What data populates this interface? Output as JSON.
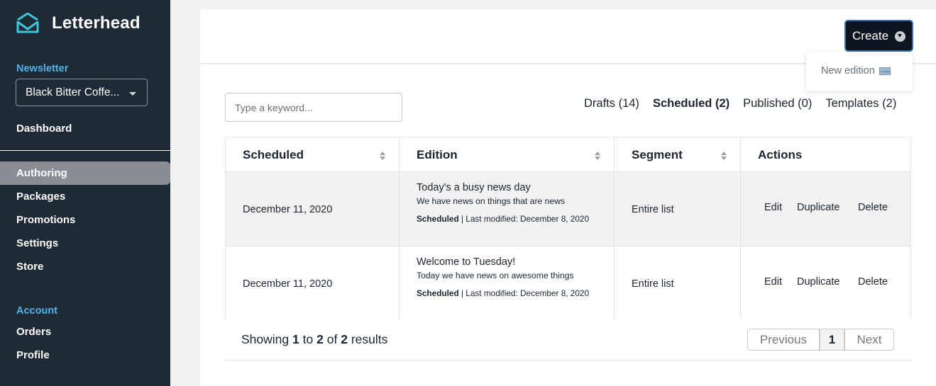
{
  "brand": {
    "name": "Letterhead"
  },
  "sidebar": {
    "newsletter_label": "Newsletter",
    "newsletter_value": "Black Bitter Coffe...",
    "dashboard": "Dashboard",
    "items": [
      {
        "label": "Authoring",
        "active": true
      },
      {
        "label": "Packages"
      },
      {
        "label": "Promotions"
      },
      {
        "label": "Settings"
      },
      {
        "label": "Store"
      }
    ],
    "account_label": "Account",
    "account_items": [
      {
        "label": "Orders"
      },
      {
        "label": "Profile"
      }
    ]
  },
  "header": {
    "create_label": "Create",
    "dropdown_item": "New edition"
  },
  "search": {
    "placeholder": "Type a keyword..."
  },
  "tabs": [
    {
      "label": "Drafts (14)"
    },
    {
      "label": "Scheduled (2)",
      "active": true
    },
    {
      "label": "Published (0)"
    },
    {
      "label": "Templates (2)"
    }
  ],
  "table": {
    "columns": [
      "Scheduled",
      "Edition",
      "Segment",
      "Actions"
    ],
    "rows": [
      {
        "scheduled": "December 11, 2020",
        "title": "Today's a busy news day",
        "description": "We have news on things that are news",
        "status": "Scheduled",
        "modified": "| Last modified: December 8, 2020",
        "segment": "Entire list",
        "actions": [
          "Edit",
          "Duplicate",
          "Delete"
        ]
      },
      {
        "scheduled": "December 11, 2020",
        "title": "Welcome to Tuesday!",
        "description": "Today we have news on awesome things",
        "status": "Scheduled",
        "modified": "| Last modified: December 8, 2020",
        "segment": "Entire list",
        "actions": [
          "Edit",
          "Duplicate",
          "Delete"
        ]
      }
    ]
  },
  "pagination": {
    "showing": "Showing",
    "from": "1",
    "to_word": "to",
    "to": "2",
    "of_word": "of",
    "total": "2",
    "results_word": "results",
    "previous": "Previous",
    "current": "1",
    "next": "Next"
  },
  "colors": {
    "sidebar_bg": "#1e2a36",
    "accent": "#4fb3e8",
    "logo": "#3ec7d9",
    "active_nav": "#888e94"
  }
}
